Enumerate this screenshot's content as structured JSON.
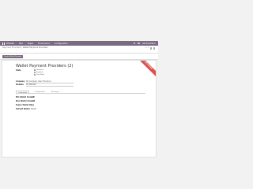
{
  "navbar": {
    "menu": [
      "Website",
      "Site",
      "Pages",
      "Ecommerce",
      "Configuration"
    ],
    "user": "Administrator"
  },
  "control": {
    "breadcrumb_parent": "Payment Providers",
    "breadcrumb_current": "Wallet Payment Providers",
    "pager": "1 / 1"
  },
  "actions": {
    "primary_label": "Create Wallet Provider"
  },
  "record": {
    "title": "Wallet Payment Providers (2)",
    "ribbon": "ARCHIVED",
    "state": {
      "label": "State",
      "options": [
        "Disabled",
        "Enabled",
        "Test Mode"
      ],
      "selected": 0
    },
    "company": {
      "label": "Company",
      "value": "My Company (San Francisco)"
    },
    "website": {
      "label": "Website",
      "value": "My Website"
    },
    "tabs": [
      "Credentials",
      "Configuration",
      "Messages"
    ],
    "fields": [
      {
        "label": "Min Wallet Amount",
        "value": "0.00"
      },
      {
        "label": "Max Wallet Amount",
        "value": "0.00"
      },
      {
        "label": "Expiry Wallet Days",
        "value": "0"
      },
      {
        "label": "Default Wallet",
        "value": "Wallet"
      }
    ]
  },
  "colors": {
    "brand": "#7c6a84",
    "ribbon": "#d9534f"
  }
}
